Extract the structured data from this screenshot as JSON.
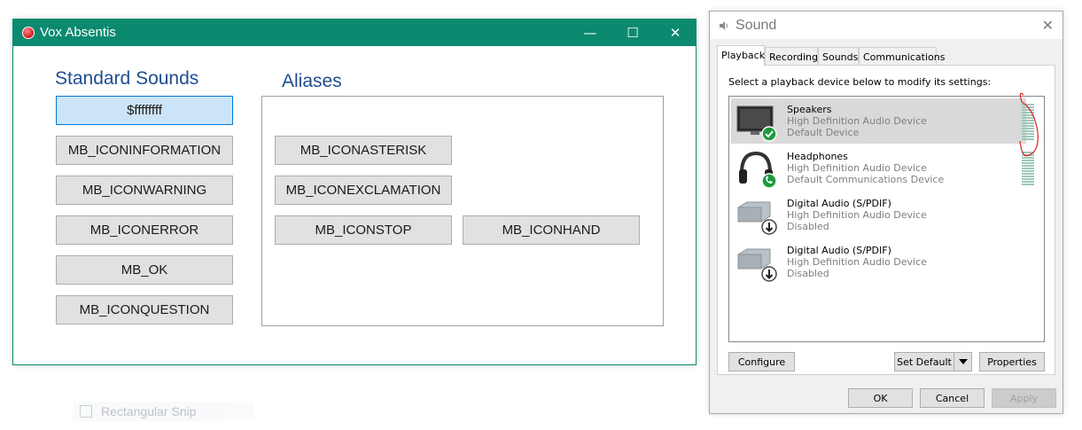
{
  "vox": {
    "title": "Vox Absentis",
    "minimize": "—",
    "maximize": "☐",
    "close": "✕",
    "standard_heading": "Standard Sounds",
    "aliases_heading": "Aliases",
    "standard_buttons": [
      "$ffffffff",
      "MB_ICONINFORMATION",
      "MB_ICONWARNING",
      "MB_ICONERROR",
      "MB_OK",
      "MB_ICONQUESTION"
    ],
    "alias_buttons": [
      "MB_ICONASTERISK",
      "MB_ICONEXCLAMATION",
      "MB_ICONSTOP",
      "MB_ICONHAND"
    ],
    "accent": "#0b8a6f"
  },
  "sound": {
    "title": "Sound",
    "close": "✕",
    "tabs": [
      "Playback",
      "Recording",
      "Sounds",
      "Communications"
    ],
    "active_tab": "Playback",
    "instruction": "Select a playback device below to modify its settings:",
    "devices": [
      {
        "name": "Speakers",
        "driver": "High Definition Audio Device",
        "status": "Default Device",
        "icon": "speaker-monitor-icon"
      },
      {
        "name": "Headphones",
        "driver": "High Definition Audio Device",
        "status": "Default Communications Device",
        "icon": "headphones-icon"
      },
      {
        "name": "Digital Audio (S/PDIF)",
        "driver": "High Definition Audio Device",
        "status": "Disabled",
        "icon": "spdif-icon"
      },
      {
        "name": "Digital Audio (S/PDIF)",
        "driver": "High Definition Audio Device",
        "status": "Disabled",
        "icon": "spdif-icon"
      }
    ],
    "configure": "Configure",
    "set_default": "Set Default",
    "properties": "Properties",
    "ok": "OK",
    "cancel": "Cancel",
    "apply": "Apply"
  },
  "snip": {
    "label": "Rectangular Snip"
  }
}
